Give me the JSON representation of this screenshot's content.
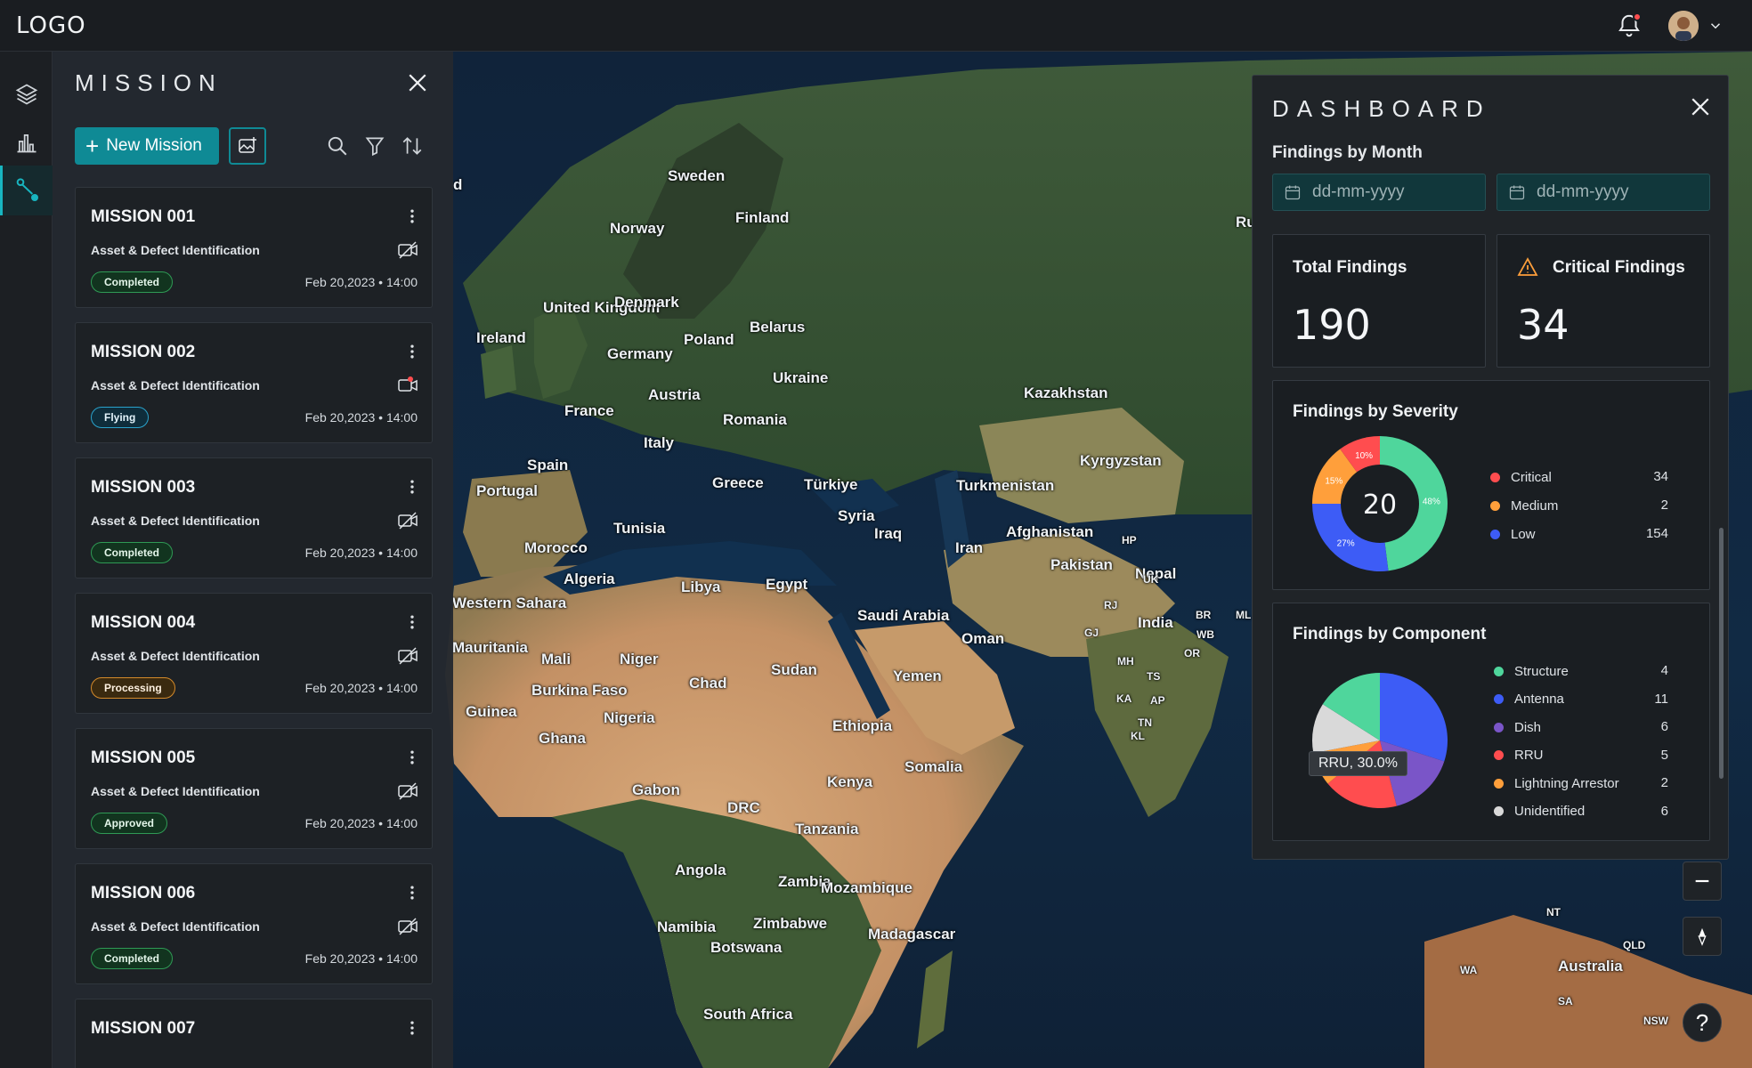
{
  "app": {
    "logo": "LOGO"
  },
  "colors": {
    "accent": "#0f8a95",
    "critical": "#ff4d4f",
    "medium": "#ff9f3b",
    "low": "#3d5cf6",
    "good": "#4fd69c"
  },
  "rail": {
    "items": [
      {
        "icon": "layers-icon"
      },
      {
        "icon": "bar-chart-icon"
      },
      {
        "icon": "route-icon",
        "active": true
      }
    ]
  },
  "mission": {
    "title": "MISSION",
    "new_button": "New Mission",
    "missions": [
      {
        "name": "MISSION 001",
        "subtitle": "Asset & Defect Identification",
        "status": "Completed",
        "date": "Feb 20,2023 • 14:00",
        "camera": "camera-off-icon"
      },
      {
        "name": "MISSION 002",
        "subtitle": "Asset & Defect Identification",
        "status": "Flying",
        "date": "Feb 20,2023 • 14:00",
        "camera": "camera-live-icon"
      },
      {
        "name": "MISSION 003",
        "subtitle": "Asset & Defect Identification",
        "status": "Completed",
        "date": "Feb 20,2023 • 14:00",
        "camera": "camera-off-icon"
      },
      {
        "name": "MISSION 004",
        "subtitle": "Asset & Defect Identification",
        "status": "Processing",
        "date": "Feb 20,2023 • 14:00",
        "camera": "camera-off-icon"
      },
      {
        "name": "MISSION 005",
        "subtitle": "Asset & Defect Identification",
        "status": "Approved",
        "date": "Feb 20,2023 • 14:00",
        "camera": "camera-off-icon"
      },
      {
        "name": "MISSION 006",
        "subtitle": "Asset & Defect Identification",
        "status": "Completed",
        "date": "Feb 20,2023 • 14:00",
        "camera": "camera-off-icon"
      },
      {
        "name": "MISSION 007",
        "subtitle": "",
        "status": "",
        "date": "",
        "camera": ""
      }
    ]
  },
  "dashboard": {
    "title": "DASHBOARD",
    "findings_by_month": "Findings by Month",
    "date_from_placeholder": "dd-mm-yyyy",
    "date_to_placeholder": "dd-mm-yyyy",
    "total_findings": {
      "label": "Total Findings",
      "value": "190"
    },
    "critical_findings": {
      "label": "Critical Findings",
      "value": "34"
    },
    "severity": {
      "title": "Findings by Severity",
      "center": "20",
      "rows": [
        {
          "label": "Critical",
          "count": "34",
          "color": "#ff4d4f"
        },
        {
          "label": "Medium",
          "count": "2",
          "color": "#ff9f3b"
        },
        {
          "label": "Low",
          "count": "154",
          "color": "#3d5cf6"
        }
      ]
    },
    "component": {
      "title": "Findings by Component",
      "tooltip": "RRU, 30.0%",
      "rows": [
        {
          "label": "Structure",
          "count": "4",
          "color": "#4fd69c"
        },
        {
          "label": "Antenna",
          "count": "11",
          "color": "#3d5cf6"
        },
        {
          "label": "Dish",
          "count": "6",
          "color": "#7a55c8"
        },
        {
          "label": "RRU",
          "count": "5",
          "color": "#ff4d4f"
        },
        {
          "label": "Lightning Arrestor",
          "count": "2",
          "color": "#ff9f3b"
        },
        {
          "label": "Unidentified",
          "count": "6",
          "color": "#d9d9d9"
        }
      ]
    }
  },
  "chart_data": [
    {
      "type": "pie",
      "title": "Findings by Severity",
      "slices": [
        {
          "label": "Green",
          "value": 48
        },
        {
          "label": "Blue",
          "value": 27
        },
        {
          "label": "Orange",
          "value": 15
        },
        {
          "label": "Red",
          "value": 10
        }
      ],
      "slice_labels": [
        "48%",
        "27%",
        "15%",
        "10%"
      ],
      "slice_colors": [
        "#4fd69c",
        "#3d5cf6",
        "#ff9f3b",
        "#ff4d4f"
      ]
    },
    {
      "type": "pie",
      "title": "Findings by Component",
      "slices": [
        {
          "label": "Antenna",
          "value": 30
        },
        {
          "label": "Dish",
          "value": 16
        },
        {
          "label": "RRU",
          "value": 18
        },
        {
          "label": "Lightning Arrestor",
          "value": 8
        },
        {
          "label": "Unidentified",
          "value": 12
        },
        {
          "label": "Structure",
          "value": 16
        }
      ],
      "slice_colors": [
        "#3d5cf6",
        "#7a55c8",
        "#ff4d4f",
        "#ff9f3b",
        "#d9d9d9",
        "#4fd69c"
      ]
    }
  ],
  "map": {
    "labels": [
      "Sweden",
      "Finland",
      "Norway",
      "United Kingdom",
      "Denmark",
      "Ireland",
      "Belarus",
      "Poland",
      "Germany",
      "Ukraine",
      "Austria",
      "France",
      "Romania",
      "Italy",
      "Kazakhstan",
      "Spain",
      "Portugal",
      "Greece",
      "Türkiye",
      "Turkmenistan",
      "Kyrgyzstan",
      "Syria",
      "Iraq",
      "Tunisia",
      "Afghanistan",
      "Iran",
      "Pakistan",
      "Morocco",
      "Algeria",
      "Libya",
      "Egypt",
      "Nepal",
      "Western Sahara",
      "India",
      "Saudi Arabia",
      "Oman",
      "Mauritania",
      "Mali",
      "Niger",
      "Sudan",
      "Chad",
      "Yemen",
      "Guinea",
      "Burkina Faso",
      "Nigeria",
      "Ethiopia",
      "Ghana",
      "Somalia",
      "Kenya",
      "Gabon",
      "DRC",
      "Tanzania",
      "Angola",
      "Zambia",
      "Mozambique",
      "Zimbabwe",
      "Namibia",
      "Madagascar",
      "Botswana",
      "South Africa",
      "Australia",
      "Guinea",
      "Ru",
      "HP",
      "UK",
      "RJ",
      "GJ",
      "MH",
      "TS",
      "KA",
      "AP",
      "TN",
      "KL",
      "BR",
      "WB",
      "OR",
      "ML",
      "NT",
      "QLD",
      "WA",
      "SA",
      "NSW",
      "d"
    ]
  }
}
